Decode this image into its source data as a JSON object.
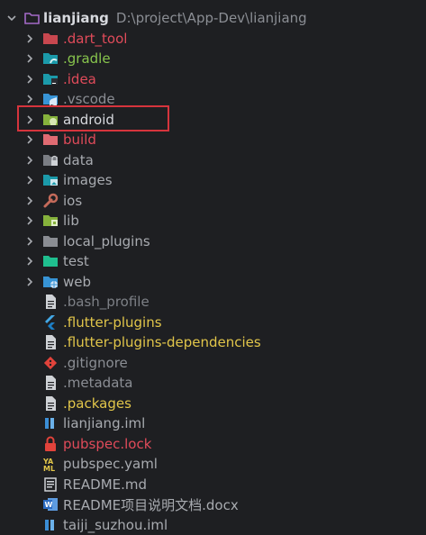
{
  "root": {
    "name": "lianjiang",
    "path": "D:\\project\\App-Dev\\lianjiang"
  },
  "items": [
    {
      "label": ".dart_tool",
      "type": "folder",
      "color": "#e04b5a",
      "folder": "#c8474f",
      "badge": ""
    },
    {
      "label": ".gradle",
      "type": "folder",
      "color": "#87c44d",
      "folder": "#1b9aaa",
      "badge": "gradle"
    },
    {
      "label": ".idea",
      "type": "folder",
      "color": "#e04b5a",
      "folder": "#1b9aaa",
      "badge": "idea"
    },
    {
      "label": ".vscode",
      "type": "folder",
      "color": "#8b8e94",
      "folder": "#3794d6",
      "badge": "vscode"
    },
    {
      "label": "android",
      "type": "folder",
      "color": "#d7d9de",
      "folder": "#86b23c",
      "badge": "android"
    },
    {
      "label": "build",
      "type": "folder",
      "color": "#e04b5a",
      "folder": "#e06b72",
      "badge": ""
    },
    {
      "label": "data",
      "type": "folder",
      "color": "#a8abb0",
      "folder": "#7b7e84",
      "badge": "lock"
    },
    {
      "label": "images",
      "type": "folder",
      "color": "#a8abb0",
      "folder": "#1b9aaa",
      "badge": "image"
    },
    {
      "label": "ios",
      "type": "folder",
      "color": "#a8abb0",
      "folder": "",
      "badge": "wrench"
    },
    {
      "label": "lib",
      "type": "folder",
      "color": "#a8abb0",
      "folder": "#86b23c",
      "badge": "lib"
    },
    {
      "label": "local_plugins",
      "type": "folder",
      "color": "#a8abb0",
      "folder": "#8a8d93",
      "badge": ""
    },
    {
      "label": "test",
      "type": "folder",
      "color": "#a8abb0",
      "folder": "#1fbf8f",
      "badge": ""
    },
    {
      "label": "web",
      "type": "folder",
      "color": "#a8abb0",
      "folder": "#3794d6",
      "badge": "globe"
    },
    {
      "label": ".bash_profile",
      "type": "file",
      "color": "#7d8086",
      "icon": "document"
    },
    {
      "label": ".flutter-plugins",
      "type": "file",
      "color": "#e2c64a",
      "icon": "flutter"
    },
    {
      "label": ".flutter-plugins-dependencies",
      "type": "file",
      "color": "#e2c64a",
      "icon": "document"
    },
    {
      "label": ".gitignore",
      "type": "file",
      "color": "#8b8e94",
      "icon": "git"
    },
    {
      "label": ".metadata",
      "type": "file",
      "color": "#8b8e94",
      "icon": "document"
    },
    {
      "label": ".packages",
      "type": "file",
      "color": "#e2c64a",
      "icon": "document"
    },
    {
      "label": "lianjiang.iml",
      "type": "file",
      "color": "#a8abb0",
      "icon": "iml"
    },
    {
      "label": "pubspec.lock",
      "type": "file",
      "color": "#e04b5a",
      "icon": "lock"
    },
    {
      "label": "pubspec.yaml",
      "type": "file",
      "color": "#a8abb0",
      "icon": "yaml"
    },
    {
      "label": "README.md",
      "type": "file",
      "color": "#a8abb0",
      "icon": "markdown"
    },
    {
      "label": "README项目说明文档.docx",
      "type": "file",
      "color": "#a8abb0",
      "icon": "word"
    },
    {
      "label": "taiji_suzhou.iml",
      "type": "file",
      "color": "#a8abb0",
      "icon": "iml"
    }
  ]
}
